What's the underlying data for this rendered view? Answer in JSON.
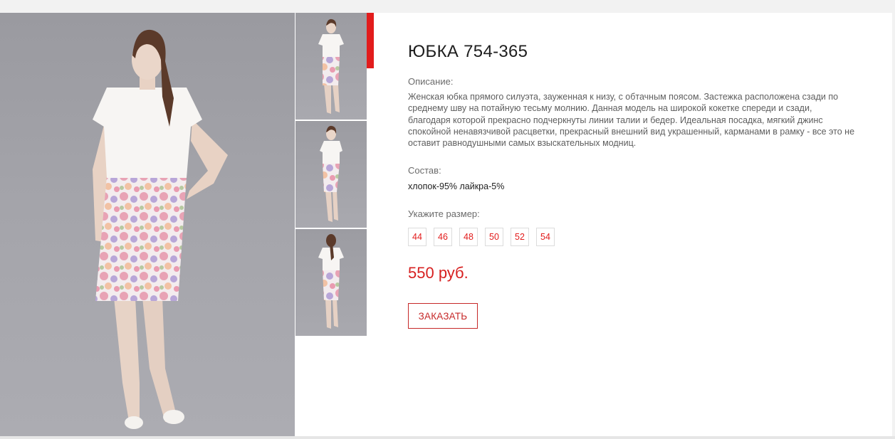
{
  "product": {
    "title": "ЮБКА 754-365",
    "description_label": "Описание:",
    "description": "Женская юбка прямого силуэта, зауженная к низу, с обтачным поясом. Застежка расположена сзади по среднему шву на потайную тесьму молнию. Данная модель на широкой кокетке спереди и сзади, благодаря которой прекрасно подчеркнуты линии талии и бедер. Идеальная посадка, мягкий джинс спокойной ненавязчивой расцветки, прекрасный внешний вид украшенный, карманами в рамку - все это не оставит равнодушными самых взыскательных модниц.",
    "composition_label": "Состав:",
    "composition": "хлопок-95% лайкра-5%",
    "size_label": "Укажите размер:",
    "sizes": [
      "44",
      "46",
      "48",
      "50",
      "52",
      "54"
    ],
    "price": "550 руб.",
    "order_label": "ЗАКАЗАТЬ"
  },
  "gallery": {
    "main_image": "model-front-photo",
    "thumbnails": [
      "model-front-thumb",
      "model-side-thumb",
      "model-back-thumb"
    ]
  },
  "colors": {
    "accent": "#e21c1c",
    "price": "#d72020",
    "photo_background": "#a4a4aa"
  }
}
